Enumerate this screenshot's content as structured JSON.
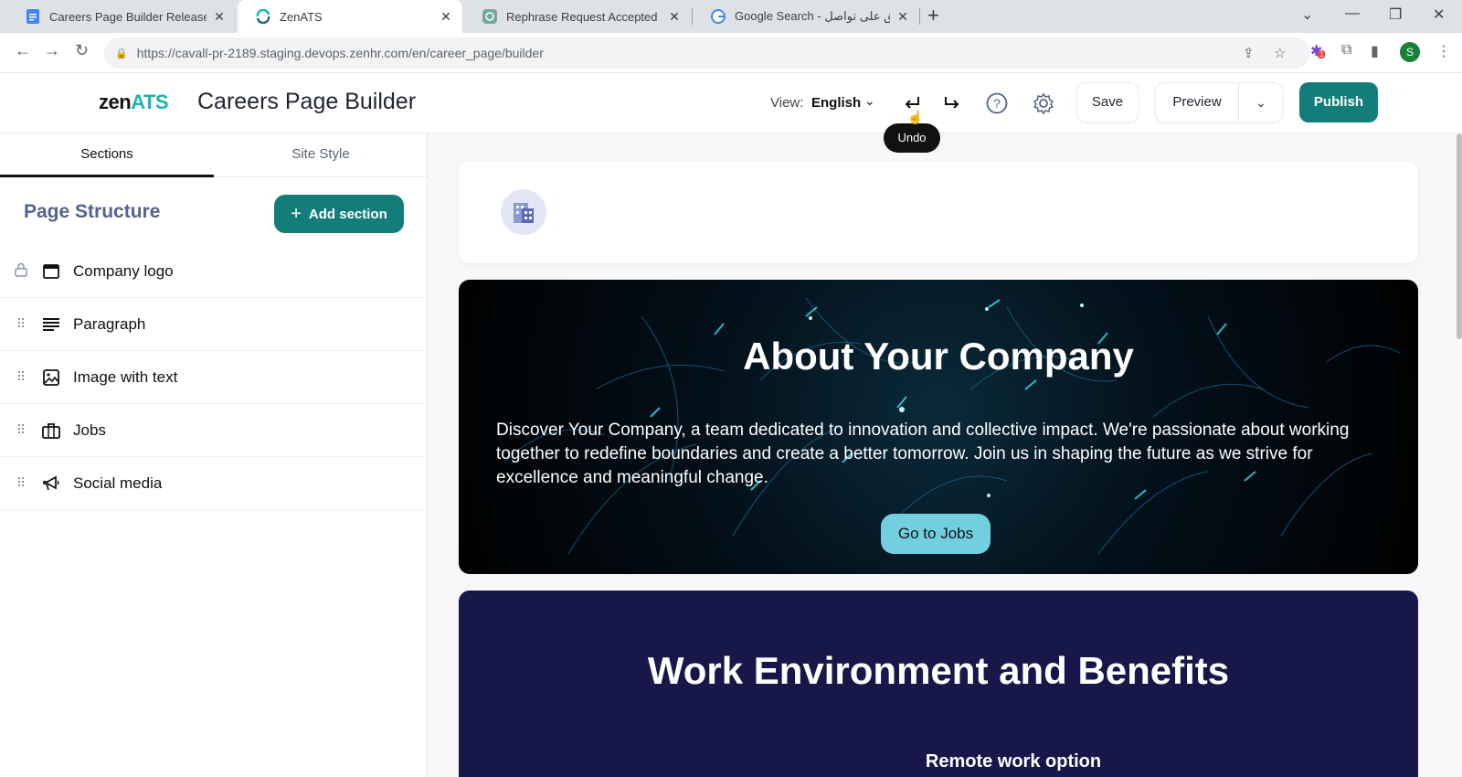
{
  "browser": {
    "tabs": [
      {
        "title": "Careers Page Builder Release No",
        "icon": "google-docs-icon"
      },
      {
        "title": "ZenATS",
        "icon": "zenats-icon"
      },
      {
        "title": "Rephrase Request Accepted",
        "icon": "chatgpt-icon"
      },
      {
        "title": "Google Search - لتنق على تواصل",
        "icon": "google-icon"
      }
    ],
    "url": "https://cavall-pr-2189.staging.devops.zenhr.com/en/career_page/builder",
    "profile_initial": "S",
    "extension_badge": "1"
  },
  "header": {
    "logo_part1": "zen",
    "logo_part2": "ATS",
    "title": "Careers Page Builder",
    "view_label": "View:",
    "view_value": "English",
    "save_label": "Save",
    "preview_label": "Preview",
    "publish_label": "Publish",
    "tooltip": "Undo",
    "accent_color": "#137e79"
  },
  "sidebar": {
    "tabs": [
      {
        "label": "Sections",
        "active": true
      },
      {
        "label": "Site Style",
        "active": false
      }
    ],
    "title": "Page Structure",
    "add_button": "Add section",
    "sections": [
      {
        "label": "Company logo",
        "icon": "browser-window-icon",
        "locked": true
      },
      {
        "label": "Paragraph",
        "icon": "paragraph-lines-icon",
        "locked": false
      },
      {
        "label": "Image with text",
        "icon": "image-icon",
        "locked": false
      },
      {
        "label": "Jobs",
        "icon": "briefcase-icon",
        "locked": false
      },
      {
        "label": "Social media",
        "icon": "megaphone-icon",
        "locked": false
      }
    ]
  },
  "canvas": {
    "hero_title": "About Your Company",
    "hero_text": "Discover Your Company, a team dedicated to innovation and collective impact. We're passionate about working together to redefine boundaries and create a better tomorrow. Join us in shaping the future as we strive for excellence and meaningful change.",
    "hero_button": "Go to Jobs",
    "benefits_title": "Work Environment and Benefits",
    "benefits_item": "Remote work option"
  }
}
